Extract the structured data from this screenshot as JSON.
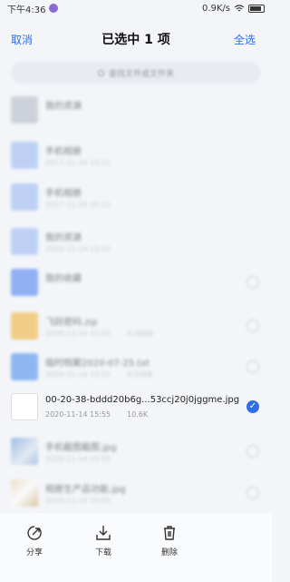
{
  "status": {
    "time": "下午4:36",
    "network": "0.9K/s"
  },
  "header": {
    "cancel": "取消",
    "title": "已选中 1 项",
    "select_all": "全选"
  },
  "search": {
    "placeholder": "查找文件或文件夹"
  },
  "files": [
    {
      "name": "我的资源",
      "meta": "",
      "size": "",
      "thumb": "doc-gray",
      "blurred": true,
      "checkbox": false
    },
    {
      "name": "手机相册",
      "meta": "2017-11-24 10:21",
      "size": "",
      "thumb": "folder light",
      "blurred": true,
      "checkbox": false
    },
    {
      "name": "手机相册",
      "meta": "2017-11-24 10:21",
      "size": "",
      "thumb": "folder light",
      "blurred": true,
      "checkbox": false
    },
    {
      "name": "我的资源",
      "meta": "2020-11-14 15:55",
      "size": "",
      "thumb": "folder light",
      "blurred": true,
      "checkbox": false
    },
    {
      "name": "我的收藏",
      "meta": "",
      "size": "",
      "thumb": "folder",
      "blurred": true,
      "checkbox": true
    },
    {
      "name": "飞跃密码.zip",
      "meta": "2020-11-14 15:55",
      "size": "4.00KB",
      "thumb": "zip",
      "blurred": true,
      "checkbox": true
    },
    {
      "name": "临时档案2020-07-25.txt",
      "meta": "2020-11-14 15:55",
      "size": "8.00KB",
      "thumb": "txt",
      "blurred": true,
      "checkbox": true
    },
    {
      "name": "00-20-38-bddd20b6g...53ccj20j0jggme.jpg",
      "meta": "2020-11-14 15:55",
      "size": "10.6K",
      "thumb": "selected",
      "blurred": false,
      "checkbox": true,
      "selected": true
    },
    {
      "name": "手机截图截图.jpg",
      "meta": "2020-11-14 15:55",
      "size": "",
      "thumb": "jpg-a",
      "blurred": true,
      "checkbox": true
    },
    {
      "name": "相册生产品功能.jpg",
      "meta": "2020-11-14 15:55",
      "size": "",
      "thumb": "jpg-b",
      "blurred": true,
      "checkbox": true
    }
  ],
  "toolbar": {
    "share": "分享",
    "download": "下载",
    "delete": "删除"
  }
}
